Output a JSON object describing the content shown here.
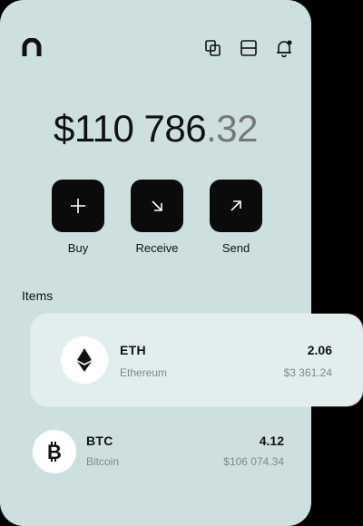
{
  "header": {
    "logo_icon": "app-logo-arch",
    "icons": [
      "copy-icon",
      "layout-icon",
      "bell-icon"
    ]
  },
  "balance": {
    "whole": "$110 786",
    "cents": ".32"
  },
  "actions": [
    {
      "label": "Buy",
      "icon": "plus-icon"
    },
    {
      "label": "Receive",
      "icon": "arrow-down-right-icon"
    },
    {
      "label": "Send",
      "icon": "arrow-up-right-icon"
    }
  ],
  "items": {
    "title": "Items",
    "list": [
      {
        "symbol": "ETH",
        "name": "Ethereum",
        "amount": "2.06",
        "value": "$3 361.24",
        "icon": "ethereum-icon"
      },
      {
        "symbol": "BTC",
        "name": "Bitcoin",
        "amount": "4.12",
        "value": "$106 074.34",
        "icon": "bitcoin-icon"
      }
    ]
  }
}
